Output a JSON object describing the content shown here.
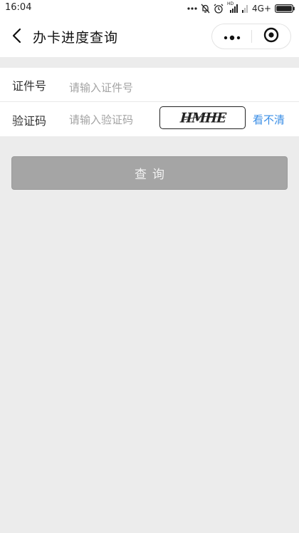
{
  "status_bar": {
    "time": "16:04",
    "hd_label": "HD",
    "network": "4G+",
    "icons": [
      "more-dots-icon",
      "mute-icon",
      "alarm-icon",
      "signal-icon",
      "signal-weak-icon",
      "battery-icon"
    ]
  },
  "nav": {
    "title": "办卡进度查询",
    "back_icon": "chevron-left-icon",
    "capsule_icons": [
      "more-icon",
      "target-close-icon"
    ]
  },
  "form": {
    "id_label": "证件号",
    "id_value": "",
    "id_placeholder": "请输入证件号",
    "code_label": "验证码",
    "code_value": "",
    "code_placeholder": "请输入验证码",
    "captcha_text": "HMHE",
    "refresh_label": "看不清"
  },
  "query_button": "查询",
  "colors": {
    "background": "#ececec",
    "link": "#3a8ee6",
    "button": "#a5a5a5"
  }
}
